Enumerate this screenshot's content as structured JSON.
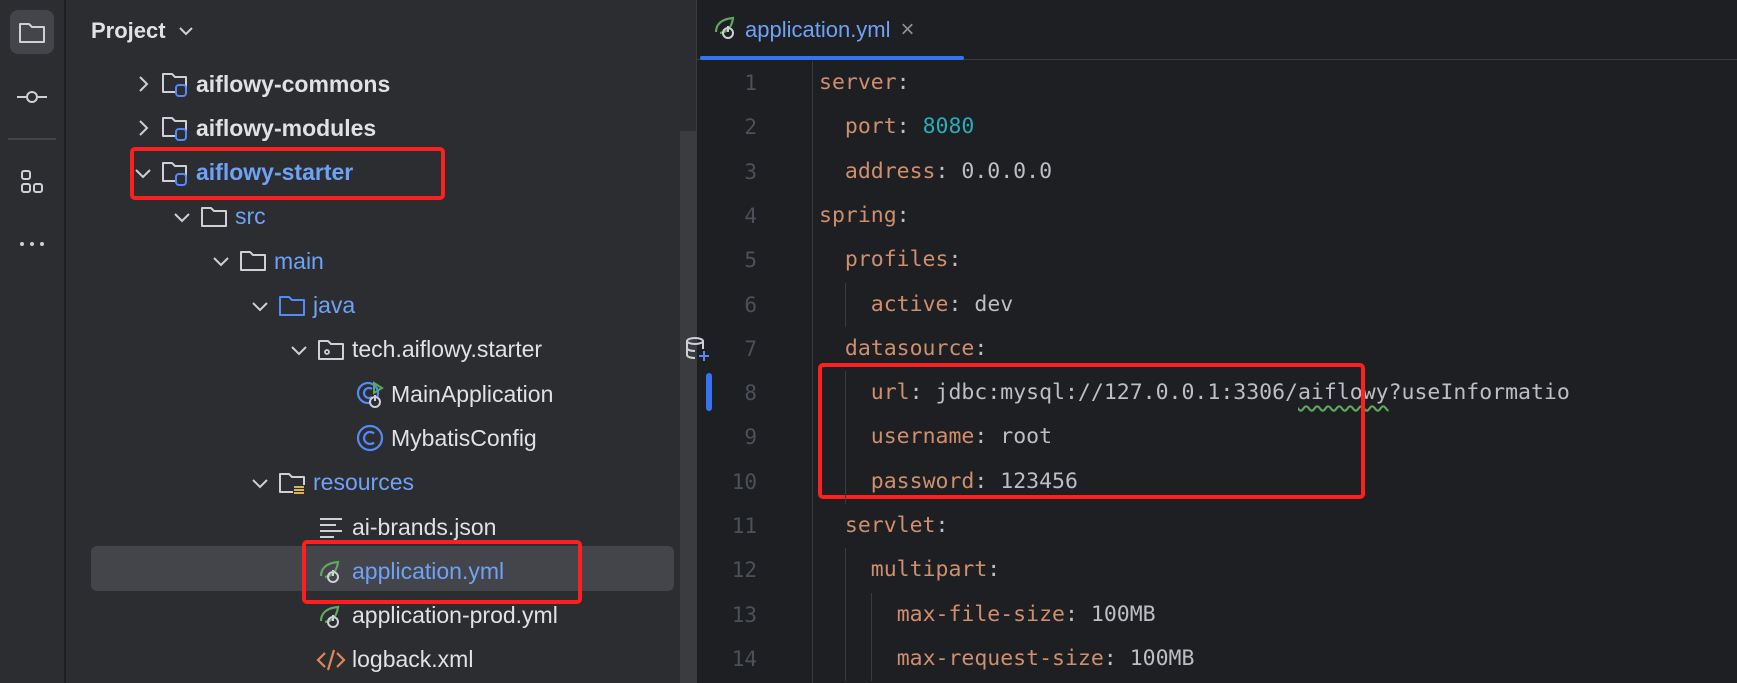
{
  "toolbar": {
    "items": [
      {
        "icon": "folder-icon",
        "active": true
      },
      {
        "icon": "commit-icon"
      },
      {
        "icon": "structure-icon"
      },
      {
        "icon": "more-icon"
      }
    ]
  },
  "project": {
    "title": "Project",
    "items": [
      {
        "label": "aiflowy-commons",
        "depth": 0,
        "chevron": "right",
        "icon": "module-folder-icon",
        "bold": true
      },
      {
        "label": "aiflowy-modules",
        "depth": 0,
        "chevron": "right",
        "icon": "module-folder-icon",
        "bold": true
      },
      {
        "label": "aiflowy-starter",
        "depth": 0,
        "chevron": "down",
        "icon": "module-folder-icon",
        "bold": true,
        "highlighted": true
      },
      {
        "label": "src",
        "depth": 1,
        "chevron": "down",
        "icon": "folder-icon"
      },
      {
        "label": "main",
        "depth": 2,
        "chevron": "down",
        "icon": "folder-icon"
      },
      {
        "label": "java",
        "depth": 3,
        "chevron": "down",
        "icon": "source-folder-icon"
      },
      {
        "label": "tech.aiflowy.starter",
        "depth": 4,
        "chevron": "down",
        "icon": "package-icon"
      },
      {
        "label": "MainApplication",
        "depth": 5,
        "icon": "spring-boot-class-icon"
      },
      {
        "label": "MybatisConfig",
        "depth": 5,
        "icon": "class-icon"
      },
      {
        "label": "resources",
        "depth": 3,
        "chevron": "down",
        "icon": "resources-folder-icon"
      },
      {
        "label": "ai-brands.json",
        "depth": 4,
        "icon": "json-file-icon"
      },
      {
        "label": "application.yml",
        "depth": 4,
        "icon": "spring-yml-icon",
        "selected": true,
        "highlighted": true
      },
      {
        "label": "application-prod.yml",
        "depth": 4,
        "icon": "spring-yml-icon"
      },
      {
        "label": "logback.xml",
        "depth": 4,
        "icon": "xml-file-icon"
      }
    ]
  },
  "editor": {
    "tab": {
      "label": "application.yml",
      "icon": "spring-yml-icon",
      "close": "×"
    },
    "lines": [
      {
        "n": "1",
        "indent": 0,
        "key": "server",
        "value": ""
      },
      {
        "n": "2",
        "indent": 1,
        "key": "port",
        "value": "8080",
        "type": "number"
      },
      {
        "n": "3",
        "indent": 1,
        "key": "address",
        "value": "0.0.0.0"
      },
      {
        "n": "4",
        "indent": 0,
        "key": "spring",
        "value": ""
      },
      {
        "n": "5",
        "indent": 1,
        "key": "profiles",
        "value": ""
      },
      {
        "n": "6",
        "indent": 2,
        "key": "active",
        "value": "dev"
      },
      {
        "n": "7",
        "indent": 1,
        "key": "datasource",
        "value": "",
        "gutter_icon": "database-add-icon"
      },
      {
        "n": "8",
        "indent": 2,
        "key": "url",
        "value": "jdbc:mysql://127.0.0.1:3306/",
        "squiggle": "aiflowy",
        "value_after": "?useInformatio"
      },
      {
        "n": "9",
        "indent": 2,
        "key": "username",
        "value": "root"
      },
      {
        "n": "10",
        "indent": 2,
        "key": "password",
        "value": "123456"
      },
      {
        "n": "11",
        "indent": 1,
        "key": "servlet",
        "value": ""
      },
      {
        "n": "12",
        "indent": 2,
        "key": "multipart",
        "value": ""
      },
      {
        "n": "13",
        "indent": 3,
        "key": "max-file-size",
        "value": "100MB"
      },
      {
        "n": "14",
        "indent": 3,
        "key": "max-request-size",
        "value": "100MB"
      }
    ]
  },
  "colors": {
    "key": "#cf8e6d",
    "number": "#2aacb8",
    "value": "#bcbec4",
    "accent": "#3574f0",
    "highlight": "#ff1f1f"
  }
}
